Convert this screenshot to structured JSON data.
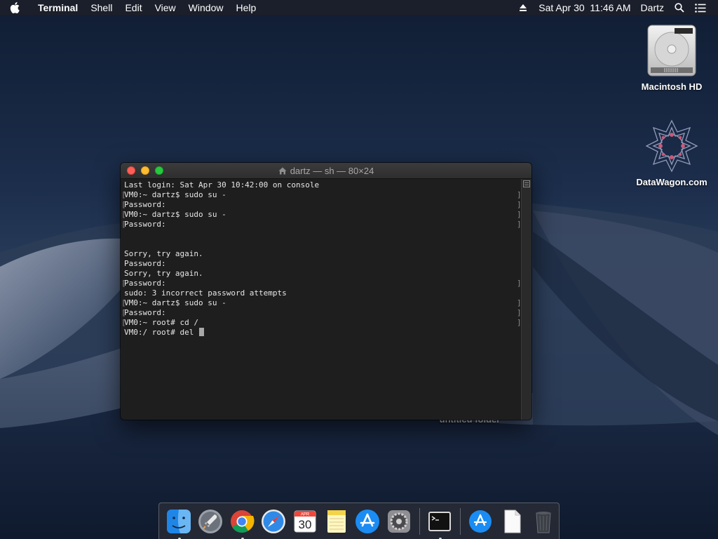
{
  "menubar": {
    "app_name": "Terminal",
    "items": [
      "Shell",
      "Edit",
      "View",
      "Window",
      "Help"
    ],
    "datetime": "Sat Apr 30  11:46 AM",
    "user": "Dartz",
    "icons": [
      "apple-icon",
      "eject-icon",
      "spotlight-search-icon",
      "notification-center-icon"
    ]
  },
  "desktop": {
    "icons": [
      {
        "label": "Macintosh HD",
        "icon": "hard-drive-icon"
      },
      {
        "label": "DataWagon.com",
        "icon": "datawagon-logo-icon"
      }
    ],
    "partial_label": "untitled folder"
  },
  "terminal": {
    "title": "dartz — sh — 80×24",
    "lines": [
      {
        "text": "Last login: Sat Apr 30 10:42:00 on console",
        "marked": false
      },
      {
        "text": "VM0:~ dartz$ sudo su -",
        "marked": true
      },
      {
        "text": "Password:",
        "marked": true
      },
      {
        "text": "VM0:~ dartz$ sudo su -",
        "marked": true
      },
      {
        "text": "Password:",
        "marked": true
      },
      {
        "text": "",
        "marked": false
      },
      {
        "text": "",
        "marked": false
      },
      {
        "text": "Sorry, try again.",
        "marked": false
      },
      {
        "text": "Password:",
        "marked": false
      },
      {
        "text": "Sorry, try again.",
        "marked": false
      },
      {
        "text": "Password:",
        "marked": true
      },
      {
        "text": "sudo: 3 incorrect password attempts",
        "marked": false
      },
      {
        "text": "VM0:~ dartz$ sudo su -",
        "marked": true
      },
      {
        "text": "Password:",
        "marked": true
      },
      {
        "text": "VM0:~ root# cd /",
        "marked": true
      },
      {
        "text": "VM0:/ root# del ",
        "marked": false,
        "cursor": true
      }
    ]
  },
  "dock": {
    "apps": [
      {
        "icon": "finder-icon",
        "running": true
      },
      {
        "icon": "launchpad-icon",
        "running": false
      },
      {
        "icon": "chrome-icon",
        "running": true
      },
      {
        "icon": "safari-icon",
        "running": false
      },
      {
        "icon": "calendar-icon",
        "running": false,
        "month": "APR",
        "day": "30"
      },
      {
        "icon": "notes-icon",
        "running": false
      },
      {
        "icon": "app-store-icon",
        "running": false
      },
      {
        "icon": "system-preferences-icon",
        "running": false
      },
      {
        "icon": "terminal-icon",
        "running": true
      },
      {
        "icon": "downloads-app-store-icon",
        "running": false
      },
      {
        "icon": "document-icon",
        "running": false
      },
      {
        "icon": "trash-icon",
        "running": false
      }
    ]
  },
  "colors": {
    "menubar_bg": "#1c202a",
    "terminal_bg": "#1e1e1e",
    "terminal_text": "#e6e6e6",
    "close": "#fe5f57",
    "minimize": "#febc2e",
    "maximize": "#28c840"
  }
}
